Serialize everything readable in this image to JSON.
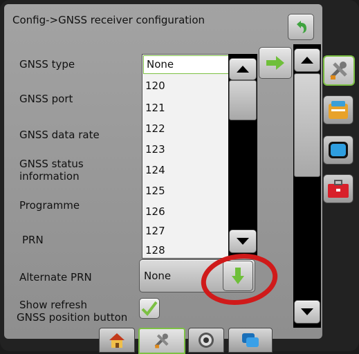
{
  "header": {
    "title": "Config->GNSS receiver configuration"
  },
  "fields": {
    "gnss_type": "GNSS type",
    "gnss_port": "GNSS port",
    "gnss_data_rate": "GNSS data rate",
    "gnss_status_line1": "GNSS status",
    "gnss_status_line2": "information",
    "programme": "Programme",
    "prn": "PRN",
    "alternate_prn": "Alternate PRN",
    "show_refresh_line1": "Show refresh",
    "show_refresh_line2": "GNSS position button"
  },
  "prn_list": {
    "selected": "None",
    "options": [
      "120",
      "121",
      "122",
      "123",
      "124",
      "125",
      "126",
      "127",
      "128"
    ]
  },
  "alternate_prn": {
    "value": "None"
  },
  "show_refresh": {
    "checked": true
  },
  "colors": {
    "accent_green": "#7cc043",
    "highlight_red": "#d01a1a"
  }
}
